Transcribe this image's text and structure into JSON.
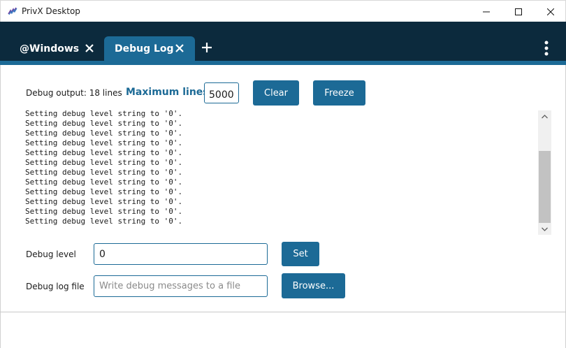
{
  "window": {
    "title": "PrivX Desktop",
    "icons": {
      "app": "privx-logo-icon",
      "minimize": "minimize-icon",
      "maximize": "maximize-icon",
      "close": "close-icon"
    }
  },
  "tabs": [
    {
      "label": "@Windows",
      "active": false,
      "close_icon": "close-icon"
    },
    {
      "label": "Debug Log",
      "active": true,
      "close_icon": "close-icon"
    }
  ],
  "tabbar_actions": {
    "new_tab_icon": "plus-icon",
    "menu_icon": "kebab-menu-icon"
  },
  "colors": {
    "tabbar_bg": "#0c2a3d",
    "accent": "#1c6a96"
  },
  "debug": {
    "output_label": "Debug output: 18 lines",
    "max_lines_label": "Maximum lines:",
    "max_lines_value": "5000",
    "clear_label": "Clear",
    "freeze_label": "Freeze",
    "log_lines": [
      "Setting debug level string to '0'.",
      "Setting debug level string to '0'.",
      "Setting debug level string to '0'.",
      "Setting debug level string to '0'.",
      "Setting debug level string to '0'.",
      "Setting debug level string to '0'.",
      "Setting debug level string to '0'.",
      "Setting debug level string to '0'.",
      "Setting debug level string to '0'.",
      "Setting debug level string to '0'.",
      "Setting debug level string to '0'.",
      "Setting debug level string to '0'."
    ],
    "scroll_icons": {
      "up": "chevron-up-icon",
      "down": "chevron-down-icon"
    },
    "level_label": "Debug level",
    "level_value": "0",
    "set_label": "Set",
    "file_label": "Debug log file",
    "file_placeholder": "Write debug messages to a file",
    "browse_label": "Browse..."
  }
}
